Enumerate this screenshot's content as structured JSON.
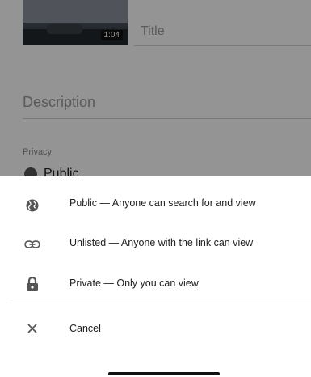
{
  "background": {
    "thumbnail_duration": "1:04",
    "title_placeholder": "Title",
    "description_placeholder": "Description",
    "privacy_label": "Privacy",
    "privacy_value": "Public"
  },
  "sheet": {
    "options": [
      {
        "label": "Public — Anyone can search for and view",
        "icon": "globe-icon"
      },
      {
        "label": "Unlisted — Anyone with the link can view",
        "icon": "link-icon"
      },
      {
        "label": "Private — Only you can view",
        "icon": "lock-icon"
      }
    ],
    "cancel_label": "Cancel",
    "cancel_icon": "close-icon"
  }
}
